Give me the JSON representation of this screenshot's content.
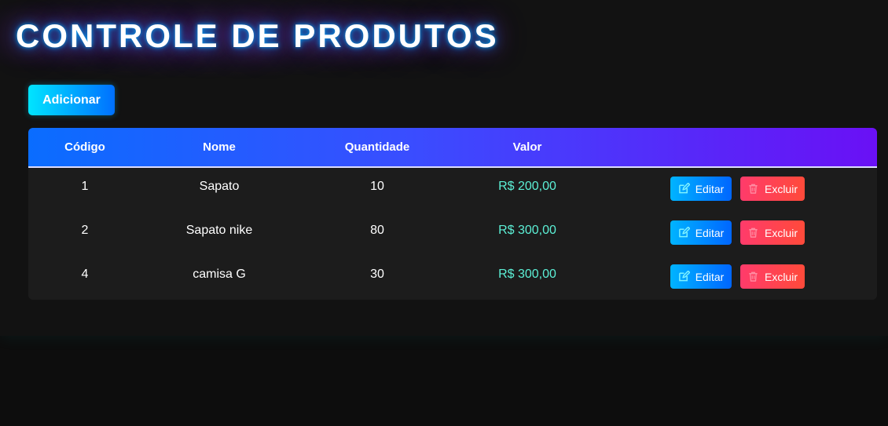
{
  "header": {
    "title": "CONTROLE DE PRODUTOS"
  },
  "toolbar": {
    "add_label": "Adicionar"
  },
  "table": {
    "columns": [
      "Código",
      "Nome",
      "Quantidade",
      "Valor",
      ""
    ],
    "rows": [
      {
        "codigo": "1",
        "nome": "Sapato",
        "quantidade": "10",
        "valor": "R$ 200,00"
      },
      {
        "codigo": "2",
        "nome": "Sapato nike",
        "quantidade": "80",
        "valor": "R$ 300,00"
      },
      {
        "codigo": "4",
        "nome": "camisa G",
        "quantidade": "30",
        "valor": "R$ 300,00"
      }
    ],
    "actions": {
      "edit_label": "Editar",
      "edit_icon": "edit-icon",
      "delete_label": "Excluir",
      "delete_icon": "trash-icon"
    }
  },
  "colors": {
    "background": "#121212",
    "accent": "#00e5ff",
    "header_gradient_start": "#0a6dff",
    "header_gradient_end": "#6a10f5",
    "value_text": "#5cf0d6",
    "delete": "#ff3b6b"
  }
}
